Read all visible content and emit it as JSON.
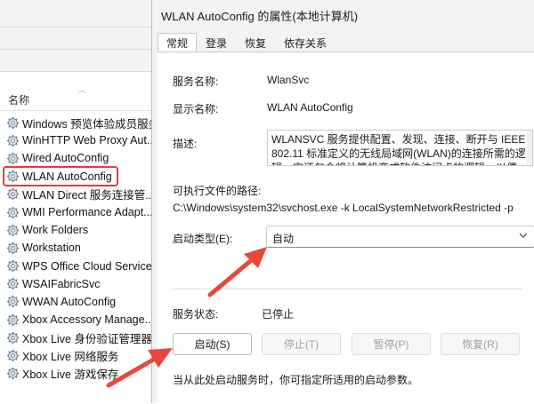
{
  "services": {
    "column_header": "名称",
    "items": [
      "Windows 预览体验成员服务",
      "WinHTTP Web Proxy Aut...",
      "Wired AutoConfig",
      "WLAN AutoConfig",
      "WLAN Direct 服务连接管...",
      "WMI Performance Adapt...",
      "Work Folders",
      "Workstation",
      "WPS Office Cloud Service",
      "WSAIFabricSvc",
      "WWAN AutoConfig",
      "Xbox Accessory Manage...",
      "Xbox Live 身份验证管理器",
      "Xbox Live 网络服务",
      "Xbox Live 游戏保存"
    ],
    "highlighted": "WLAN AutoConfig"
  },
  "dialog": {
    "title": "WLAN AutoConfig 的属性(本地计算机)",
    "tabs": [
      "常规",
      "登录",
      "恢复",
      "依存关系"
    ],
    "active_tab": "常规",
    "service_name_label": "服务名称:",
    "service_name_value": "WlanSvc",
    "display_name_label": "显示名称:",
    "display_name_value": "WLAN AutoConfig",
    "description_label": "描述:",
    "description_value": "WLANSVC 服务提供配置、发现、连接、断开与 IEEE 802.11 标准定义的无线局域网(WLAN)的连接所需的逻辑。它还包含将计算机变成软件访问点的逻辑，以便",
    "exe_path_label": "可执行文件的路径:",
    "exe_path_value": "C:\\Windows\\system32\\svchost.exe -k LocalSystemNetworkRestricted -p",
    "startup_type_label": "启动类型(E):",
    "startup_type_value": "自动",
    "status_label": "服务状态:",
    "status_value": "已停止",
    "buttons": {
      "start": "启动(S)",
      "stop": "停止(T)",
      "pause": "暂停(P)",
      "resume": "恢复(R)"
    },
    "hint": "当从此处启动服务时，你可指定所适用的启动参数。"
  },
  "colors": {
    "highlight_border": "#e53935",
    "annotation_arrow": "#e8473c",
    "dialog_bg": "#f3f3f3",
    "panel_bg": "#ffffff"
  },
  "icons": [
    "gear-icon",
    "chevron-down-icon",
    "arrow-annotation"
  ]
}
